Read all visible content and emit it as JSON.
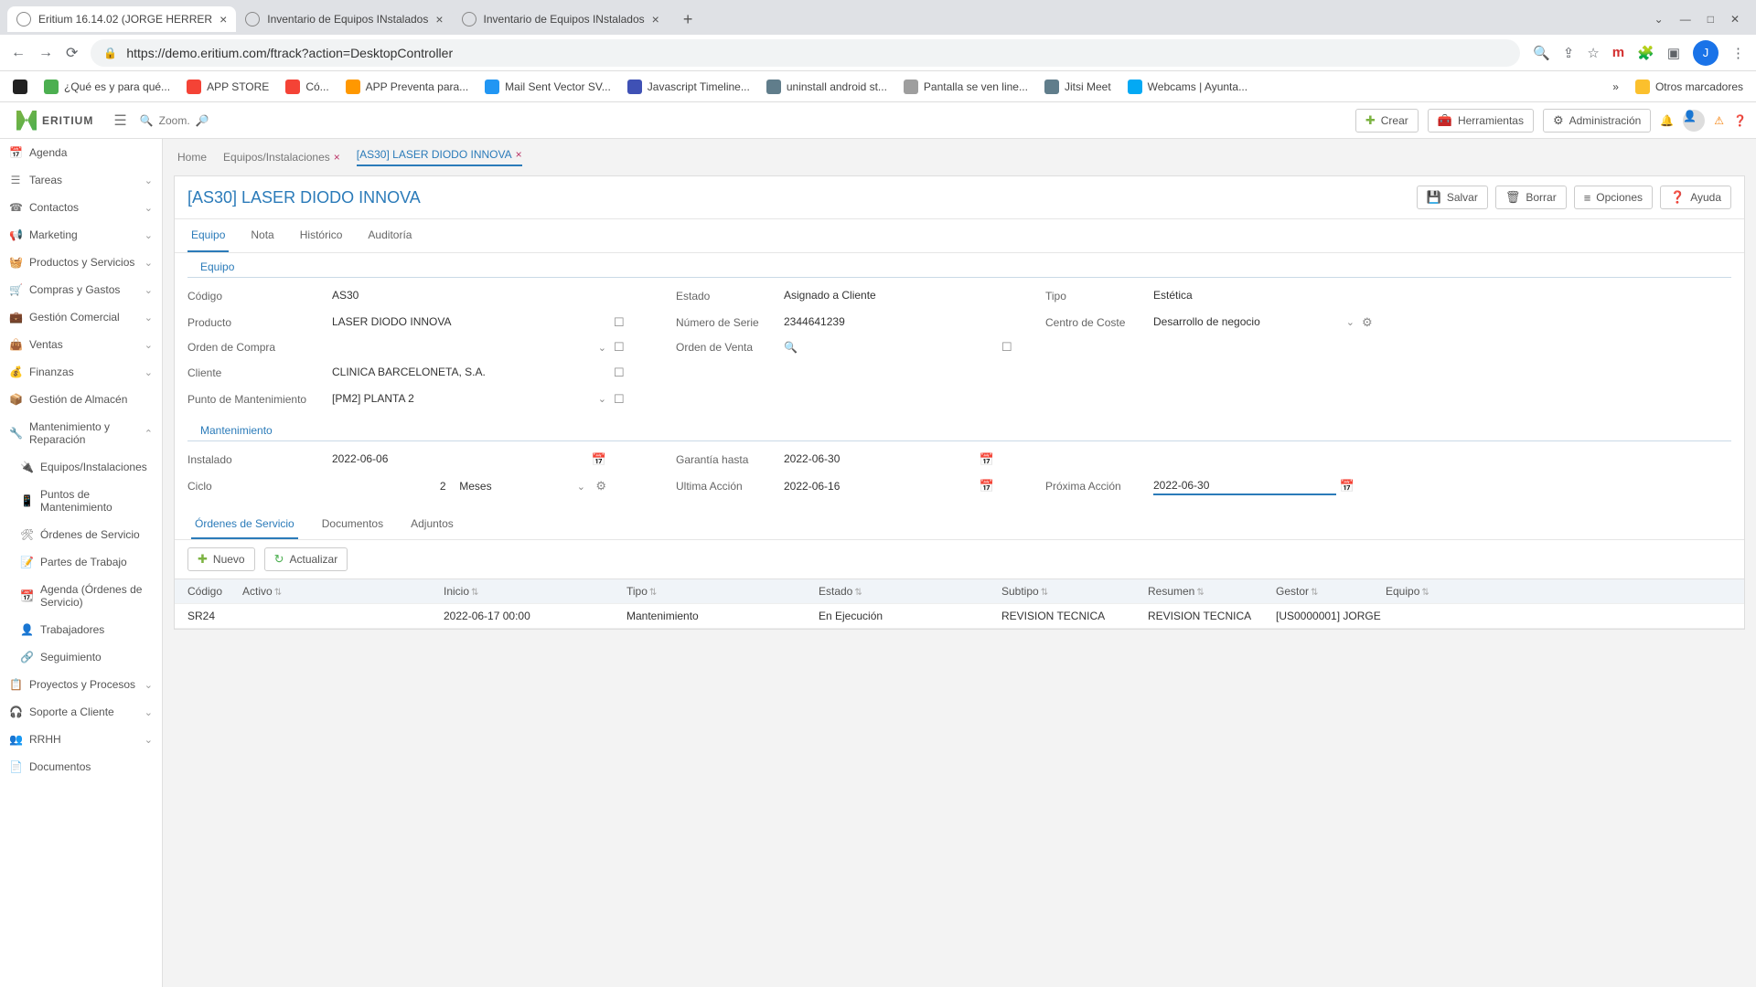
{
  "browser": {
    "tabs": [
      {
        "title": "Eritium 16.14.02 (JORGE HERRER",
        "active": true
      },
      {
        "title": "Inventario de Equipos INstalados",
        "active": false
      },
      {
        "title": "Inventario de Equipos INstalados",
        "active": false
      }
    ],
    "url": "https://demo.eritium.com/ftrack?action=DesktopController",
    "bookmarks": [
      "¿Qué es y para qué...",
      "APP STORE",
      "Có...",
      "APP Preventa para...",
      "Mail Sent Vector SV...",
      "Javascript Timeline...",
      "uninstall android st...",
      "Pantalla se ven line...",
      "Jitsi Meet",
      "Webcams | Ayunta..."
    ],
    "other_bookmarks": "Otros marcadores",
    "avatar_letter": "J"
  },
  "header": {
    "brand": "ERITIUM",
    "zoom": "Zoom.",
    "actions": {
      "create": "Crear",
      "tools": "Herramientas",
      "admin": "Administración"
    }
  },
  "sidebar": [
    {
      "label": "Agenda",
      "icon": "📅"
    },
    {
      "label": "Tareas",
      "icon": "☰",
      "chev": true
    },
    {
      "label": "Contactos",
      "icon": "☎",
      "chev": true
    },
    {
      "label": "Marketing",
      "icon": "📢",
      "chev": true
    },
    {
      "label": "Productos y Servicios",
      "icon": "🧺",
      "chev": true
    },
    {
      "label": "Compras y Gastos",
      "icon": "🛒",
      "chev": true
    },
    {
      "label": "Gestión Comercial",
      "icon": "💼",
      "chev": true
    },
    {
      "label": "Ventas",
      "icon": "👜",
      "chev": true
    },
    {
      "label": "Finanzas",
      "icon": "💰",
      "chev": true
    },
    {
      "label": "Gestión de Almacén",
      "icon": "📦"
    },
    {
      "label": "Mantenimiento y Reparación",
      "icon": "🔧",
      "chev": true,
      "expanded": true
    },
    {
      "label": "Equipos/Instalaciones",
      "icon": "🔌",
      "sub": true
    },
    {
      "label": "Puntos de Mantenimiento",
      "icon": "📱",
      "sub": true
    },
    {
      "label": "Órdenes de Servicio",
      "icon": "🛠",
      "sub": true
    },
    {
      "label": "Partes de Trabajo",
      "icon": "📝",
      "sub": true
    },
    {
      "label": "Agenda (Órdenes de Servicio)",
      "icon": "📆",
      "sub": true
    },
    {
      "label": "Trabajadores",
      "icon": "👤",
      "sub": true
    },
    {
      "label": "Seguimiento",
      "icon": "🔗",
      "sub": true
    },
    {
      "label": "Proyectos y Procesos",
      "icon": "📋",
      "chev": true
    },
    {
      "label": "Soporte a Cliente",
      "icon": "🎧",
      "chev": true
    },
    {
      "label": "RRHH",
      "icon": "👥",
      "chev": true
    },
    {
      "label": "Documentos",
      "icon": "📄"
    }
  ],
  "breadcrumbs": [
    {
      "label": "Home"
    },
    {
      "label": "Equipos/Instalaciones",
      "closable": true
    },
    {
      "label": "[AS30] LASER DIODO INNOVA",
      "closable": true,
      "active": true
    }
  ],
  "page": {
    "title": "[AS30] LASER DIODO INNOVA",
    "actions": {
      "save": "Salvar",
      "delete": "Borrar",
      "options": "Opciones",
      "help": "Ayuda"
    },
    "tabs": [
      "Equipo",
      "Nota",
      "Histórico",
      "Auditoría"
    ],
    "active_tab": "Equipo"
  },
  "equipo": {
    "section": "Equipo",
    "codigo": {
      "label": "Código",
      "value": "AS30"
    },
    "estado": {
      "label": "Estado",
      "value": "Asignado a Cliente"
    },
    "tipo": {
      "label": "Tipo",
      "value": "Estética"
    },
    "producto": {
      "label": "Producto",
      "value": "LASER DIODO INNOVA"
    },
    "serie": {
      "label": "Número de Serie",
      "value": "2344641239"
    },
    "centro": {
      "label": "Centro de Coste",
      "value": "Desarrollo de negocio"
    },
    "orden_compra": {
      "label": "Orden de Compra",
      "value": ""
    },
    "orden_venta": {
      "label": "Orden de Venta",
      "value": ""
    },
    "cliente": {
      "label": "Cliente",
      "value": "CLINICA BARCELONETA, S.A."
    },
    "punto": {
      "label": "Punto de Mantenimiento",
      "value": "[PM2] PLANTA 2"
    }
  },
  "mant": {
    "section": "Mantenimiento",
    "instalado": {
      "label": "Instalado",
      "value": "2022-06-06"
    },
    "garantia": {
      "label": "Garantía hasta",
      "value": "2022-06-30"
    },
    "ciclo": {
      "label": "Ciclo",
      "num": "2",
      "unit": "Meses"
    },
    "ultima": {
      "label": "Ultima Acción",
      "value": "2022-06-16"
    },
    "proxima": {
      "label": "Próxima Acción",
      "value": "2022-06-30"
    }
  },
  "sub_tabs": [
    "Órdenes de Servicio",
    "Documentos",
    "Adjuntos"
  ],
  "grid_toolbar": {
    "new": "Nuevo",
    "refresh": "Actualizar"
  },
  "grid": {
    "columns": [
      "Código",
      "Activo",
      "Inicio",
      "Tipo",
      "Estado",
      "Subtipo",
      "Resumen",
      "Gestor",
      "Equipo"
    ],
    "rows": [
      {
        "codigo": "SR24",
        "activo": "",
        "inicio": "2022-06-17 00:00",
        "tipo": "Mantenimiento",
        "estado": "En Ejecución",
        "subtipo": "REVISION TECNICA",
        "resumen": "REVISION TECNICA",
        "gestor": "[US0000001] JORGE",
        "equipo": ""
      }
    ]
  }
}
